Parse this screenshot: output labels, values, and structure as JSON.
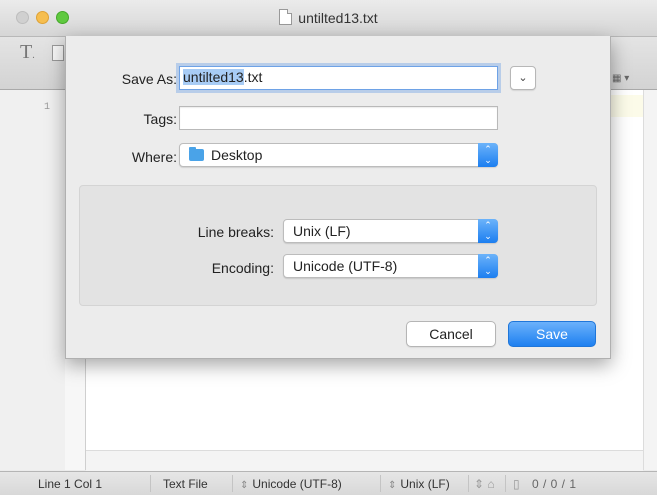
{
  "window": {
    "title": "untilted13.txt"
  },
  "editor": {
    "line_number": "1"
  },
  "statusbar": {
    "position": "Line 1 Col 1",
    "syntax": "Text File",
    "encoding": "Unicode (UTF-8)",
    "line_breaks": "Unix (LF)",
    "counts": "0 / 0 / 1"
  },
  "dialog": {
    "save_as_label": "Save As:",
    "filename_selected": "untilted13",
    "filename_ext": ".txt",
    "tags_label": "Tags:",
    "tags_value": "",
    "where_label": "Where:",
    "where_value": "Desktop",
    "line_breaks_label": "Line breaks:",
    "line_breaks_value": "Unix (LF)",
    "encoding_label": "Encoding:",
    "encoding_value": "Unicode (UTF-8)",
    "cancel_label": "Cancel",
    "save_label": "Save",
    "accent_color": "#1e80f0"
  }
}
